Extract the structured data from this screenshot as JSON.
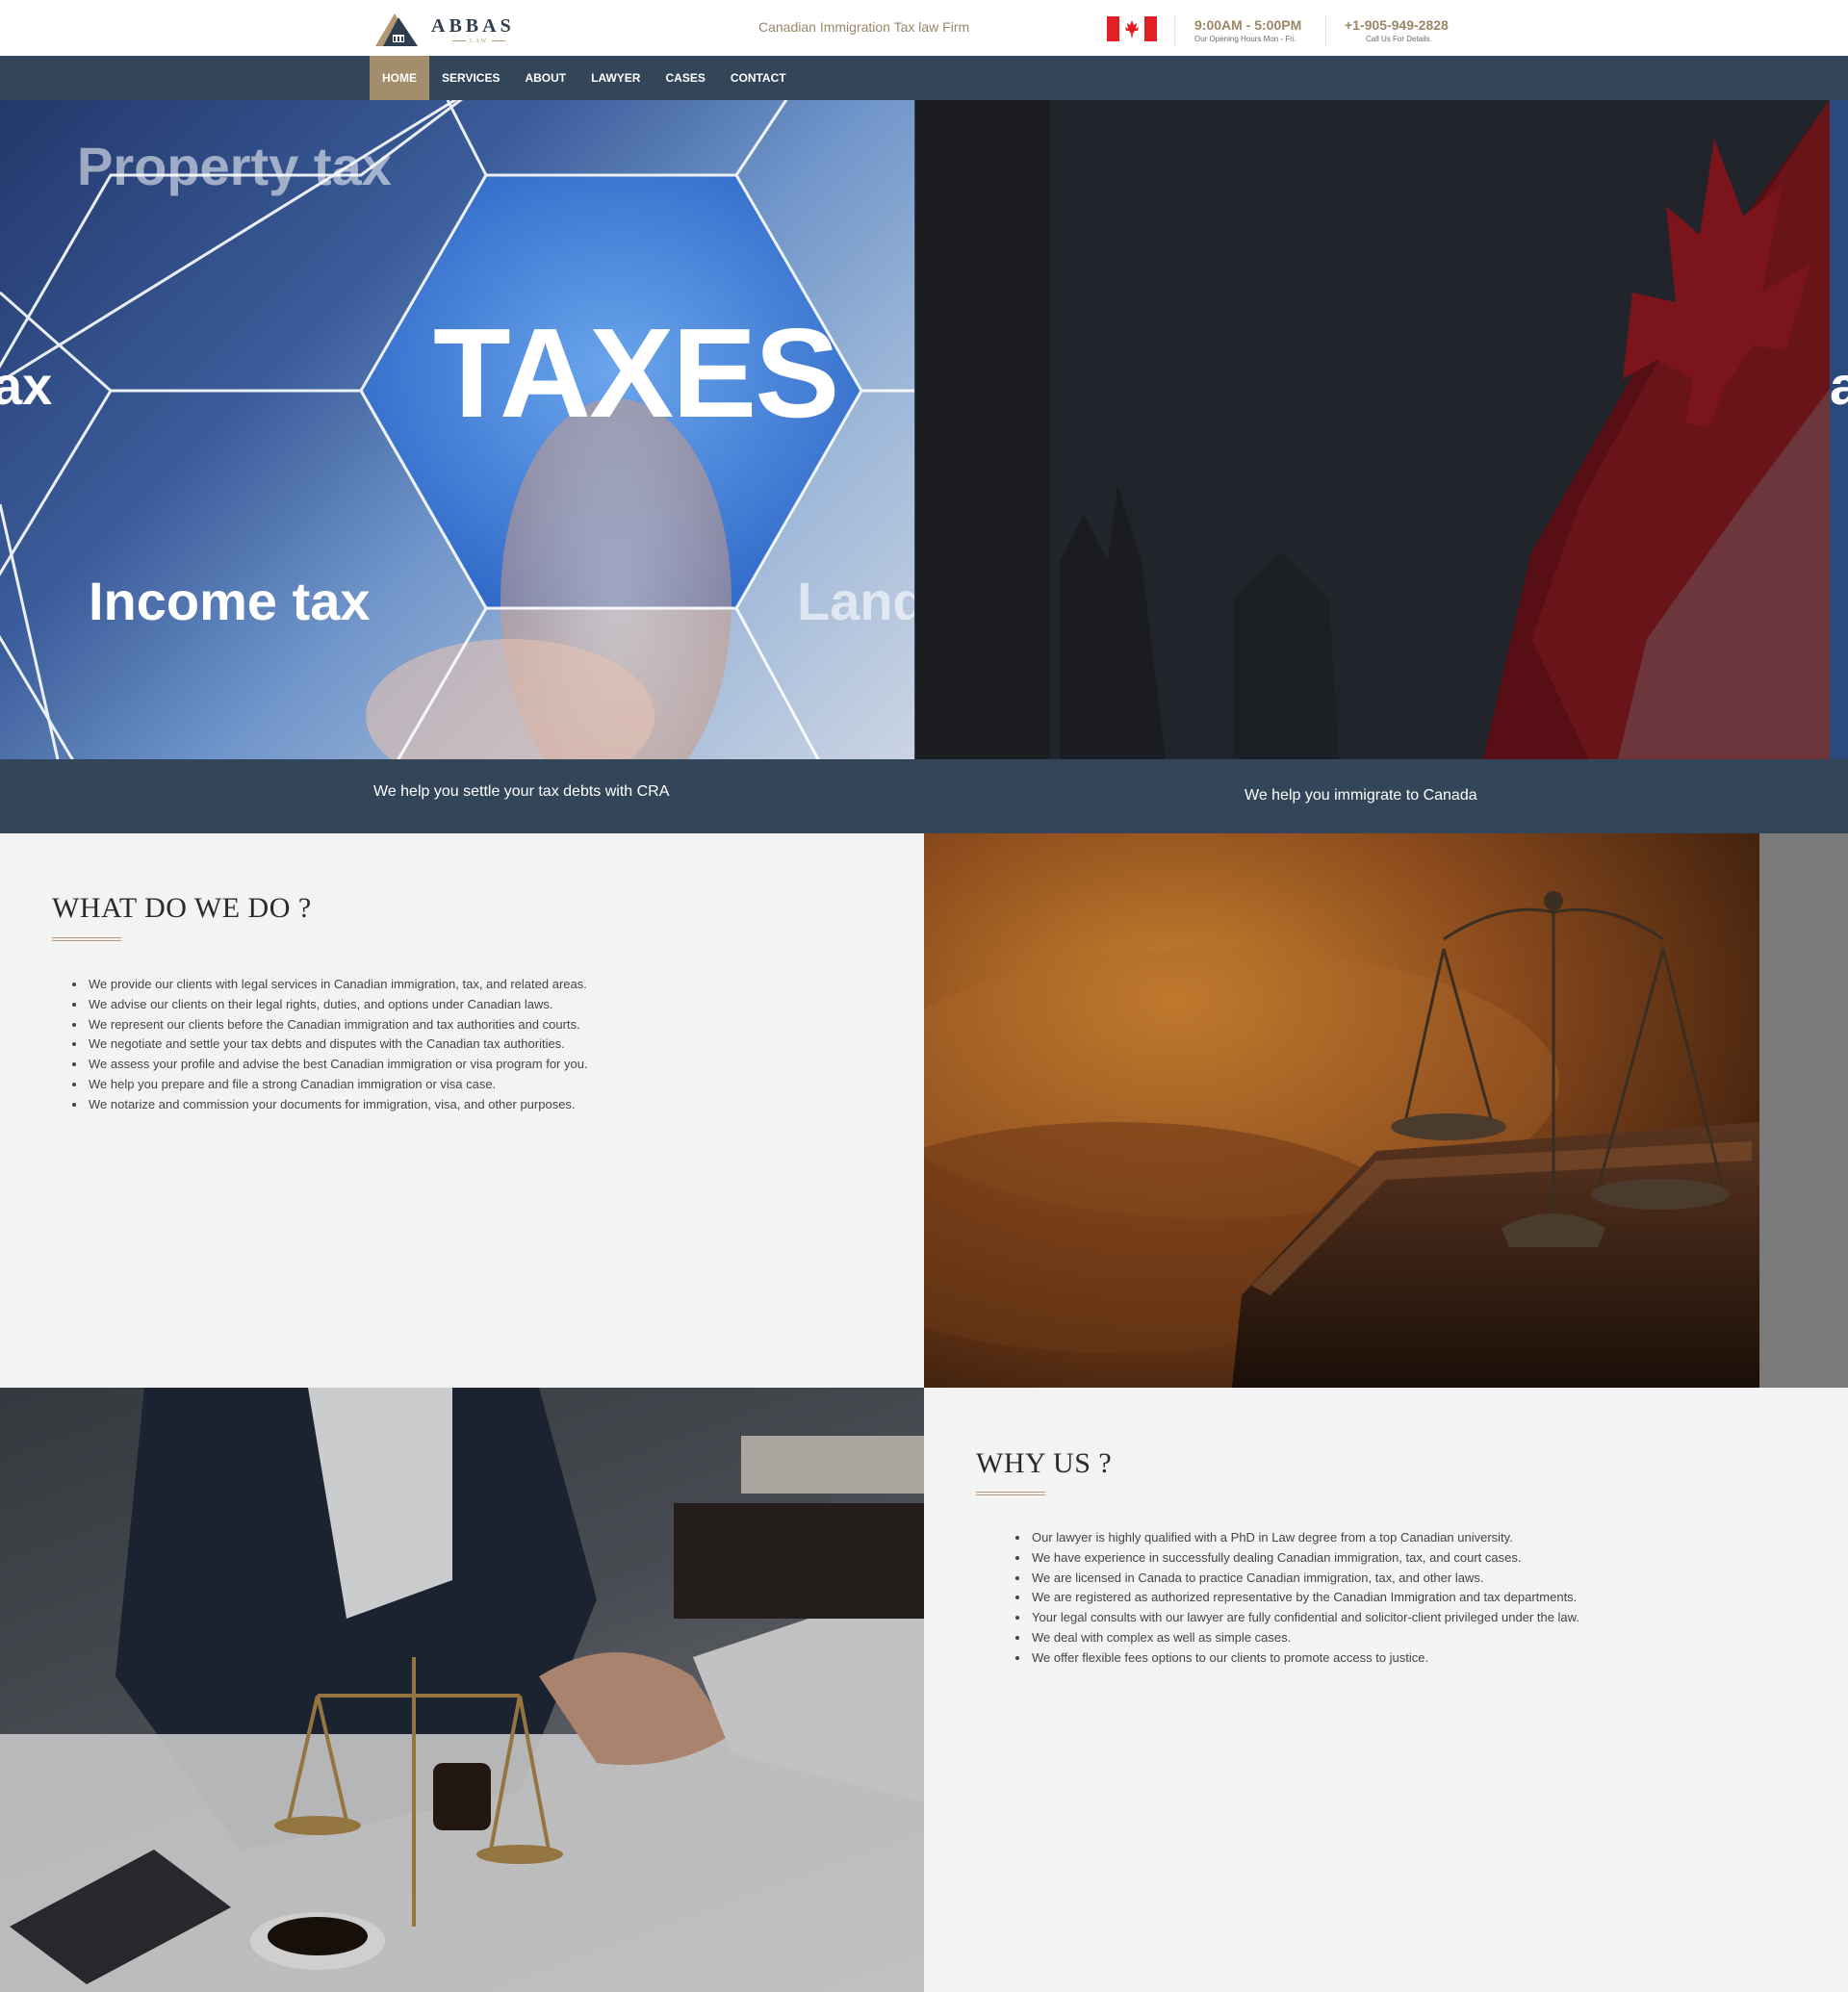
{
  "header": {
    "logo_name": "ABBAS",
    "logo_sub": "LAW",
    "tagline": "Canadian Immigration Tax law Firm",
    "hours": "9:00AM - 5:00PM",
    "hours_note": "Our Opening Hours Mon - Fri.",
    "phone": "+1-905-949-2828",
    "phone_note": "Call Us For Details"
  },
  "nav": {
    "items": [
      "HOME",
      "SERVICES",
      "ABOUT",
      "LAWYER",
      "CASES",
      "CONTACT"
    ],
    "active": "HOME"
  },
  "hero": {
    "slide1_words": {
      "property": "Property tax",
      "taxes": "TAXES",
      "income": "Income tax",
      "land": "Land",
      "left_fragment": "ax"
    },
    "caption1": "We help you settle your tax debts with CRA",
    "caption2": "We help you immigrate to Canada",
    "right_fragment": "ax"
  },
  "what": {
    "title": "WHAT DO WE DO ?",
    "items": [
      "We provide our clients with legal services in Canadian immigration, tax, and related areas.",
      "We advise our clients on their legal rights, duties, and options under Canadian laws.",
      "We represent our clients before the Canadian immigration and tax authorities and courts.",
      "We negotiate and settle your tax debts and disputes with the Canadian tax authorities.",
      "We assess your profile and advise the best Canadian immigration or visa program for you.",
      "We help you prepare and file a strong Canadian immigration or visa case.",
      "We notarize and commission your documents for immigration, visa, and other purposes."
    ]
  },
  "why": {
    "title": "WHY US ?",
    "items": [
      "Our lawyer is highly qualified with a PhD in Law degree from a top Canadian university.",
      "We have experience in successfully dealing Canadian immigration, tax, and court cases.",
      "We are licensed in Canada to practice Canadian immigration, tax, and other laws.",
      "We are registered as authorized representative by the Canadian Immigration and tax departments.",
      "Your legal consults with our lawyer are fully confidential and solicitor-client privileged under the law.",
      "We deal with complex as well as simple cases.",
      "We offer flexible fees options to our clients to promote access to justice."
    ]
  },
  "colors": {
    "nav_bg": "#334558",
    "accent": "#a38d6d",
    "gold_text": "#9b8767",
    "section_bg": "#f3f3f3"
  },
  "icons": [
    "logo-mark-icon",
    "canada-flag-icon"
  ]
}
